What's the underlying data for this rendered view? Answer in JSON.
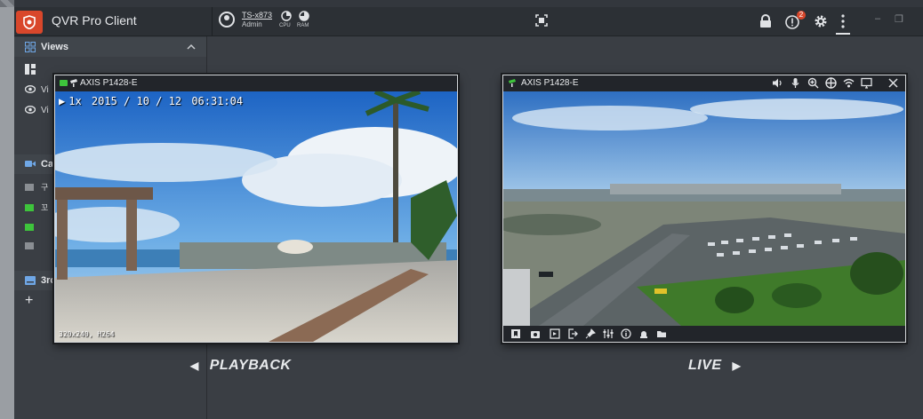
{
  "app": {
    "title": "QVR Pro Client"
  },
  "user": {
    "server": "TS-x873",
    "role": "Admin"
  },
  "gauges": [
    {
      "label": "CPU"
    },
    {
      "label": "RAM"
    }
  ],
  "notifications": {
    "count": "2"
  },
  "sidebar": {
    "views": {
      "label": "Views",
      "items": [
        "Vi",
        "Vi"
      ]
    },
    "cameras": {
      "label": "Ca",
      "items": [
        "구",
        "꼬",
        "",
        ""
      ]
    },
    "third": {
      "label": "3rc"
    }
  },
  "playback": {
    "camera": "AXIS P1428-E",
    "speed": "1x",
    "date": "2015 / 10 / 12",
    "time": "06:31:04",
    "resolution": "320x240, H264",
    "caption": "PLAYBACK"
  },
  "live": {
    "camera": "AXIS P1428-E",
    "caption": "LIVE"
  },
  "colors": {
    "accent": "#d9472b",
    "status_green": "#3ec43c",
    "background": "#33373d"
  }
}
